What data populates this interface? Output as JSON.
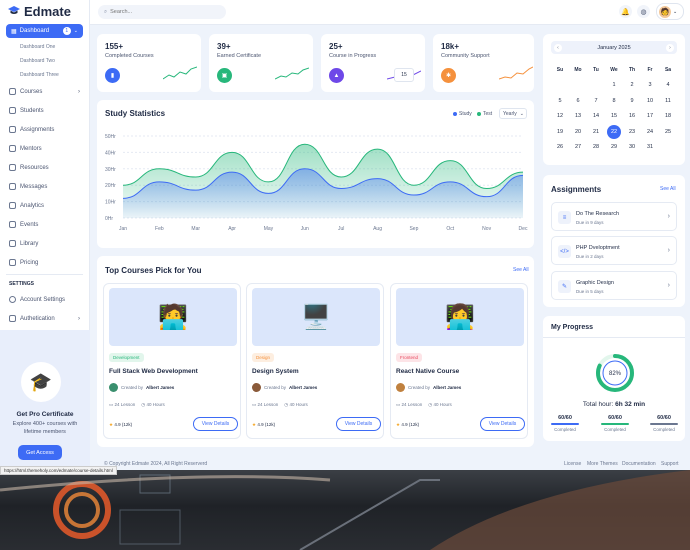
{
  "app": {
    "name": "Edmate"
  },
  "sidebar": {
    "dashboard": {
      "label": "Dashboard",
      "badge": "1"
    },
    "dashboard_subs": [
      "Dashboard One",
      "Dashboard Two",
      "Dashboard Three"
    ],
    "items": [
      {
        "label": "Courses"
      },
      {
        "label": "Students"
      },
      {
        "label": "Assignments"
      },
      {
        "label": "Mentors"
      },
      {
        "label": "Resources"
      },
      {
        "label": "Messages"
      },
      {
        "label": "Analytics"
      },
      {
        "label": "Events"
      },
      {
        "label": "Library"
      },
      {
        "label": "Pricing"
      }
    ],
    "settings_heading": "SETTINGS",
    "settings_items": [
      {
        "label": "Account Settings"
      },
      {
        "label": "Authetication"
      }
    ]
  },
  "promo": {
    "title": "Get Pro Certificate",
    "text": "Explore 400+ courses with lifetime members",
    "button": "Get Access"
  },
  "topbar": {
    "search_placeholder": "Search..."
  },
  "stats": [
    {
      "value": "155+",
      "label": "Completed Courses",
      "color": "#3d6bf5"
    },
    {
      "value": "39+",
      "label": "Earned Certificate",
      "color": "#27b77b"
    },
    {
      "value": "25+",
      "label": "Course in Progress",
      "color": "#6e48e8",
      "popup": "15"
    },
    {
      "value": "18k+",
      "label": "Community Support",
      "color": "#f5913d"
    }
  ],
  "study": {
    "title": "Study Statistics",
    "legend": [
      "Study",
      "Test"
    ],
    "period": "Yearly",
    "chart_data": {
      "type": "area",
      "x": [
        "Jan",
        "Feb",
        "Mar",
        "Apr",
        "May",
        "Jun",
        "Jul",
        "Aug",
        "Sep",
        "Oct",
        "Nov",
        "Dec"
      ],
      "ylim": [
        0,
        50
      ],
      "y_ticks": [
        "50Hr",
        "40Hr",
        "30Hr",
        "20Hr",
        "10Hr",
        "0Hr"
      ],
      "series": [
        {
          "name": "Study",
          "color": "#3d6bf5",
          "values": [
            12,
            22,
            17,
            28,
            15,
            30,
            18,
            24,
            14,
            22,
            13,
            26
          ]
        },
        {
          "name": "Test",
          "color": "#27b77b",
          "values": [
            20,
            30,
            25,
            40,
            22,
            45,
            25,
            42,
            20,
            35,
            18,
            28
          ]
        }
      ]
    }
  },
  "courses": {
    "title": "Top Courses Pick for You",
    "see_all": "See All",
    "items": [
      {
        "tag": "Development",
        "tag_color": "#27b77b",
        "tag_bg": "#e2f6ec",
        "title": "Full Stack Web Development",
        "created_prefix": "Created by",
        "author": "Albert James",
        "lessons": "24 Lesson",
        "hours": "40 Hours",
        "rating": "4.9 (12k)",
        "button": "View Details",
        "img": "🧑‍💻"
      },
      {
        "tag": "Design",
        "tag_color": "#f5913d",
        "tag_bg": "#fdeee0",
        "title": "Design System",
        "created_prefix": "Created by",
        "author": "Albert James",
        "lessons": "24 Lesson",
        "hours": "40 Hours",
        "rating": "4.9 (12k)",
        "button": "View Details",
        "img": "🖥️"
      },
      {
        "tag": "Frontend",
        "tag_color": "#e84a5f",
        "tag_bg": "#fde4e7",
        "title": "React Native Course",
        "created_prefix": "Created by",
        "author": "Albert James",
        "lessons": "24 Lesson",
        "hours": "40 Hours",
        "rating": "4.9 (12k)",
        "button": "View Details",
        "img": "👩‍💻"
      }
    ]
  },
  "calendar": {
    "month": "January 2025",
    "days": [
      "Su",
      "Mo",
      "Tu",
      "We",
      "Th",
      "Fr",
      "Sa"
    ],
    "today": "22",
    "weeks": [
      [
        "",
        "",
        "",
        "1",
        "2",
        "3",
        "4"
      ],
      [
        "5",
        "6",
        "7",
        "8",
        "9",
        "10",
        "11"
      ],
      [
        "12",
        "13",
        "14",
        "15",
        "16",
        "17",
        "18"
      ],
      [
        "19",
        "20",
        "21",
        "22",
        "23",
        "24",
        "25"
      ],
      [
        "26",
        "27",
        "28",
        "29",
        "30",
        "31",
        ""
      ]
    ]
  },
  "assignments": {
    "title": "Assignments",
    "see_all": "See All",
    "items": [
      {
        "name": "Do The Research",
        "due": "Due in 9 days",
        "icon": "list-icon"
      },
      {
        "name": "PHP Dveloptment",
        "due": "Due in 2 days",
        "icon": "code-icon"
      },
      {
        "name": "Graphic Design",
        "due": "Due in 5 days",
        "icon": "pen-icon"
      }
    ]
  },
  "progress": {
    "title": "My Progress",
    "percent_label": "82%",
    "percent": 82,
    "total_prefix": "Total hour:",
    "total": "6h 32 min",
    "cols": [
      {
        "value": "60/60",
        "label": "Completed",
        "color": "#3d6bf5"
      },
      {
        "value": "60/60",
        "label": "Completed",
        "color": "#27b77b"
      },
      {
        "value": "60/60",
        "label": "Completed",
        "color": "#6b7790"
      }
    ]
  },
  "footer": {
    "copyright": "© Copyright Edmate 2024, All Right Reserverd",
    "links": [
      "License",
      "More Themes",
      "Documentation",
      "Support"
    ]
  },
  "status_url": "https://html.themeholy.com/edmate/course-details.html"
}
